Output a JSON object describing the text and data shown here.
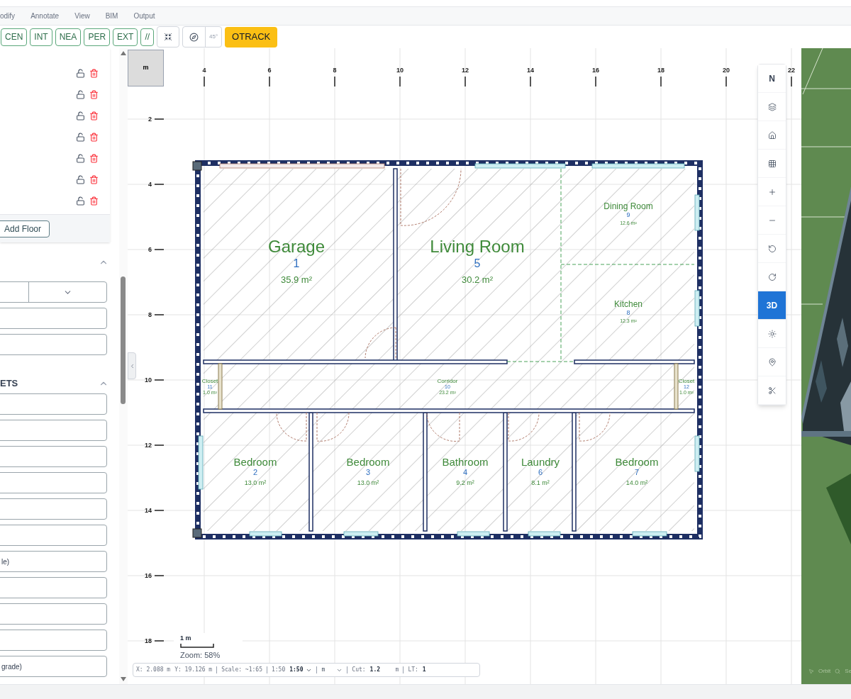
{
  "menu": [
    "odify",
    "Annotate",
    "View",
    "BIM",
    "Output"
  ],
  "toolbar": {
    "snaps": [
      {
        "label": "CEN"
      },
      {
        "label": "INT"
      },
      {
        "label": "NEA"
      },
      {
        "label": "PER"
      },
      {
        "label": "EXT"
      },
      {
        "label": "//"
      }
    ],
    "angle": "45°",
    "otrack": {
      "label": "OTRACK",
      "on": true
    }
  },
  "left_panel": {
    "layer_rows": [
      {
        "locked": false
      },
      {
        "locked": false
      },
      {
        "locked": false
      },
      {
        "locked": false
      },
      {
        "locked": false
      },
      {
        "locked": false
      },
      {
        "locked": false
      }
    ],
    "add_floor_button": "Add Floor",
    "sections": [
      {
        "expanded": true,
        "fields": [
          {
            "kind": "split-select"
          },
          {
            "kind": "input"
          },
          {
            "kind": "input"
          }
        ]
      },
      {
        "title": "ETS",
        "expanded": true,
        "fields": [
          {
            "kind": "input"
          },
          {
            "kind": "input"
          },
          {
            "kind": "input"
          },
          {
            "kind": "input"
          },
          {
            "kind": "input"
          },
          {
            "kind": "input"
          },
          {
            "kind": "input",
            "value": "le)"
          },
          {
            "kind": "input"
          },
          {
            "kind": "input"
          },
          {
            "kind": "input"
          },
          {
            "kind": "input",
            "value": "grade)"
          }
        ]
      }
    ]
  },
  "canvas": {
    "unit": "m",
    "x_ruler": [
      "4",
      "6",
      "8",
      "10",
      "12",
      "14",
      "16",
      "18",
      "20",
      "22"
    ],
    "y_ruler": [
      "2",
      "4",
      "6",
      "8",
      "10",
      "12",
      "14",
      "16",
      "18"
    ],
    "rooms": [
      {
        "name": "Garage",
        "number": "1",
        "area": "35.9 m²"
      },
      {
        "name": "Living Room",
        "number": "5",
        "area": "30.2 m²"
      },
      {
        "name": "Dining Room",
        "number": "9",
        "area": "12.6 m²"
      },
      {
        "name": "Kitchen",
        "number": "8",
        "area": "12.3 m²"
      },
      {
        "name": "Closet",
        "number": "11",
        "area": "1.0 m²"
      },
      {
        "name": "Corridor",
        "number": "10",
        "area": "23.2 m²"
      },
      {
        "name": "Closet",
        "number": "12",
        "area": "1.0 m²"
      },
      {
        "name": "Bedroom",
        "number": "2",
        "area": "13.0 m²"
      },
      {
        "name": "Bedroom",
        "number": "3",
        "area": "13.0 m²"
      },
      {
        "name": "Bathroom",
        "number": "4",
        "area": "9.2 m²"
      },
      {
        "name": "Laundry",
        "number": "6",
        "area": "8.1 m²"
      },
      {
        "name": "Bedroom",
        "number": "7",
        "area": "14.0 m²"
      }
    ],
    "scale_bar": "1 m",
    "zoom": "Zoom: 58%",
    "status_bar": {
      "x": "X: 2.088 m",
      "y": "Y: 19.126 m",
      "scale": "Scale: ~1:65",
      "ratio": "1:50",
      "ratio_select": "1:50",
      "unit_select": "m",
      "cut_label": "Cut:",
      "cut_value": "1.2",
      "cut_unit": "m",
      "lt_label": "LT:",
      "lt_value": "1"
    }
  },
  "right_toolbar": [
    {
      "kind": "text",
      "label": "N",
      "selected": false
    },
    {
      "kind": "icon",
      "selected": false
    },
    {
      "kind": "icon",
      "selected": false
    },
    {
      "kind": "icon",
      "selected": false
    },
    {
      "kind": "icon",
      "selected": false
    },
    {
      "kind": "icon",
      "selected": false
    },
    {
      "kind": "icon",
      "selected": false
    },
    {
      "kind": "icon",
      "selected": false
    },
    {
      "kind": "text",
      "label": "3D",
      "selected": true
    },
    {
      "kind": "icon",
      "selected": false
    },
    {
      "kind": "icon",
      "selected": false
    },
    {
      "kind": "icon",
      "selected": false
    }
  ],
  "viewport_3d": {
    "hints": [
      "Orbit",
      "Se"
    ]
  }
}
